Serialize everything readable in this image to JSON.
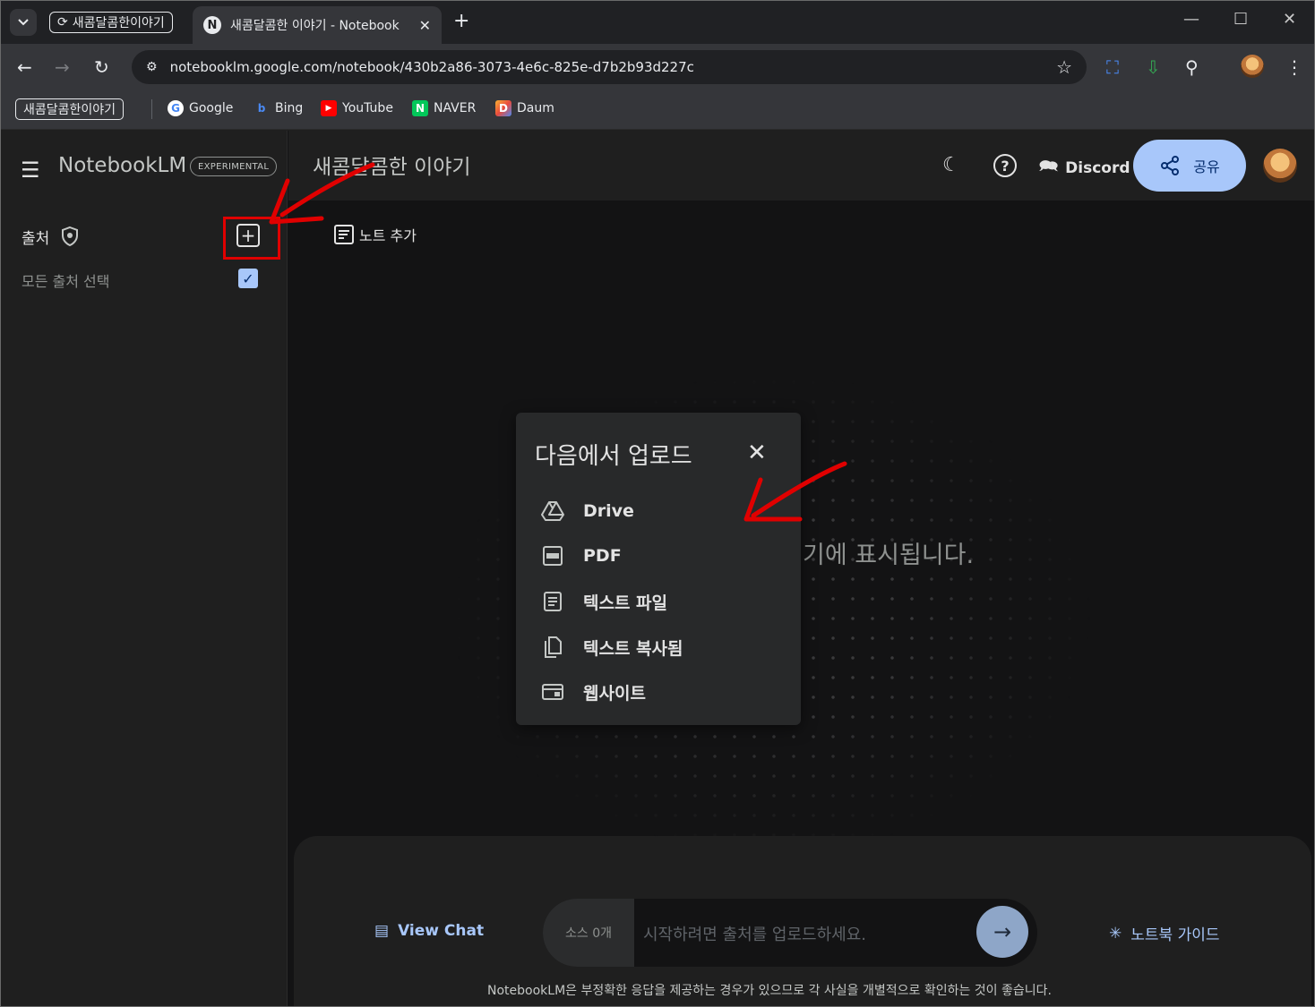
{
  "browser": {
    "tab_group_label": "새콤달콤한이야기",
    "active_tab_favicon": "N",
    "active_tab_title": "새콤달콤한 이야기 - Notebook",
    "url": "notebooklm.google.com/notebook/430b2a86-3073-4e6c-825e-d7b2b93d227c",
    "bookmarks_group_label": "새콤달콤한이야기",
    "bookmarks": [
      {
        "label": "Google",
        "icon": "G"
      },
      {
        "label": "Bing",
        "icon": "b"
      },
      {
        "label": "YouTube",
        "icon": "▶"
      },
      {
        "label": "NAVER",
        "icon": "N"
      },
      {
        "label": "Daum",
        "icon": "D"
      }
    ]
  },
  "sidebar": {
    "brand": "NotebookLM",
    "badge": "EXPERIMENTAL",
    "sources_title": "출처",
    "select_all_label": "모든 출처 선택",
    "add_source_symbol": "+"
  },
  "header": {
    "notebook_title": "새콤달콤한 이야기",
    "discord_label": "Discord",
    "share_label": "공유"
  },
  "main": {
    "add_note_label": "노트 추가",
    "empty_message_visible": "기에 표시됩니다."
  },
  "upload_dialog": {
    "title": "다음에서 업로드",
    "items": [
      {
        "label": "Drive",
        "icon": "drive-icon"
      },
      {
        "label": "PDF",
        "icon": "pdf-icon"
      },
      {
        "label": "텍스트 파일",
        "icon": "text-file-icon"
      },
      {
        "label": "텍스트 복사됨",
        "icon": "copy-icon"
      },
      {
        "label": "웹사이트",
        "icon": "website-icon"
      }
    ]
  },
  "chat": {
    "view_chat_label": "View Chat",
    "source_count": "소스 0개",
    "input_placeholder": "시작하려면 출처를 업로드하세요.",
    "notebook_guide_label": "노트북 가이드",
    "disclaimer": "NotebookLM은 부정확한 응답을 제공하는 경우가 있으므로 각 사실을 개별적으로 확인하는 것이 좋습니다."
  },
  "colors": {
    "accent": "#a8c7fa",
    "annotation_red": "#e00000"
  }
}
